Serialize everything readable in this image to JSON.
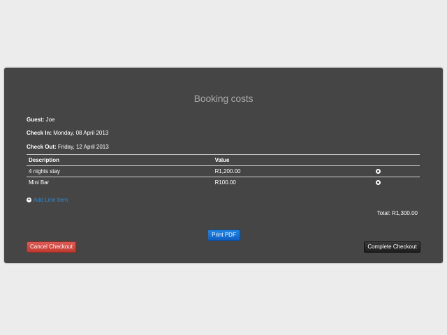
{
  "modal": {
    "title": "Booking costs",
    "guest": {
      "label": "Guest:",
      "value": "Joe"
    },
    "check_in": {
      "label": "Check In:",
      "value": "Monday, 08 April 2013"
    },
    "check_out": {
      "label": "Check Out:",
      "value": "Friday, 12 April 2013"
    },
    "table": {
      "headers": [
        "Description",
        "Value",
        ""
      ],
      "rows": [
        {
          "description": "4 nights stay",
          "value": "R1,200.00",
          "action_icon": "remove-icon"
        },
        {
          "description": "Mini Bar",
          "value": "R100.00",
          "action_icon": "remove-icon"
        }
      ]
    },
    "add_line_item": {
      "label": "Add Line Item",
      "icon": "plus-circle-icon"
    },
    "total": "Total: R1,300.00",
    "buttons": {
      "print": "Print PDF",
      "cancel": "Cancel Checkout",
      "complete": "Complete Checkout"
    },
    "colors": {
      "background": "#ececec",
      "panel": "#454545",
      "link": "#2a8ad4",
      "primary": "#1f87e6",
      "danger": "#e05a55",
      "dark": "#2a2a2a"
    }
  }
}
